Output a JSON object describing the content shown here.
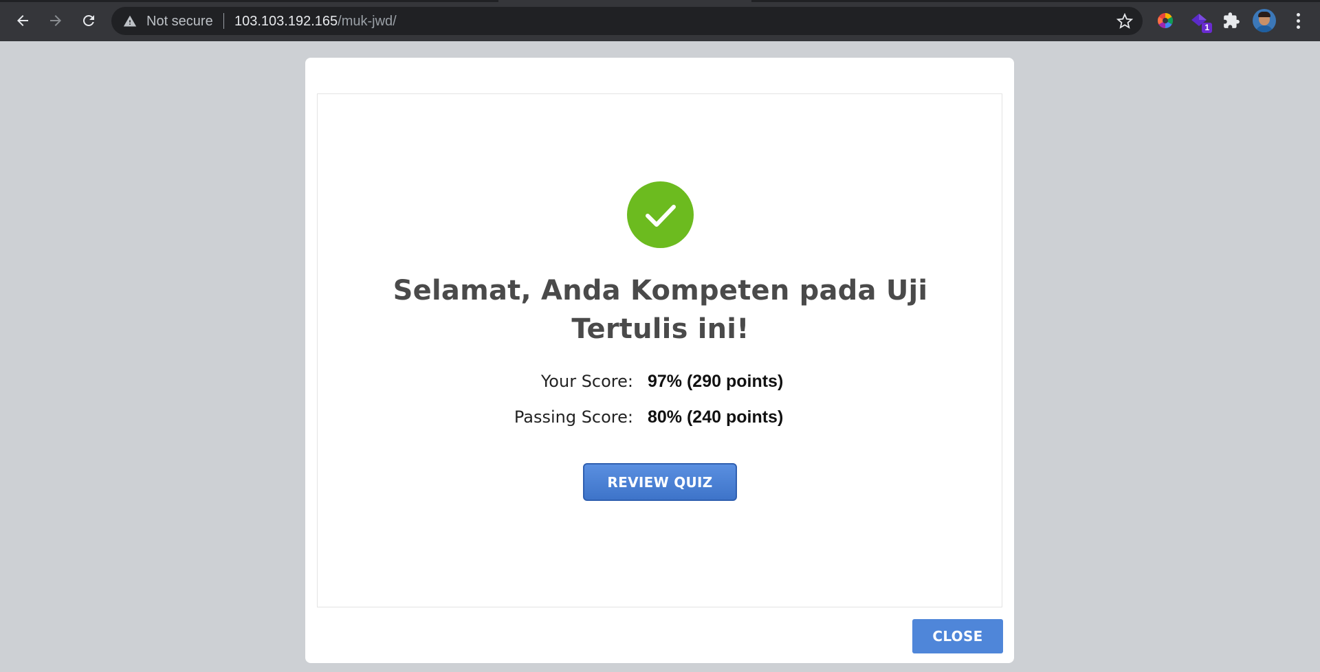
{
  "browser": {
    "security_label": "Not secure",
    "url_host": "103.103.192.165",
    "url_path": "/muk-jwd/",
    "extension_badge": "1"
  },
  "icons": {
    "back": "back-arrow-icon",
    "forward": "forward-arrow-icon",
    "reload": "reload-icon",
    "warning": "warning-icon",
    "bookmark": "star-icon",
    "extensions": "puzzle-icon",
    "menu": "three-dots-icon",
    "success": "checkmark-icon"
  },
  "colors": {
    "success_green": "#6cbb1f",
    "button_blue": "#4f86d9",
    "page_overlay": "#cdd0d4"
  },
  "result": {
    "title": "Selamat, Anda Kompeten pada Uji Tertulis ini!",
    "your_score_label": "Your Score:",
    "your_score_value": "97% (290 points)",
    "passing_score_label": "Passing Score:",
    "passing_score_value": "80% (240 points)",
    "review_button": "REVIEW QUIZ",
    "close_button": "CLOSE"
  }
}
